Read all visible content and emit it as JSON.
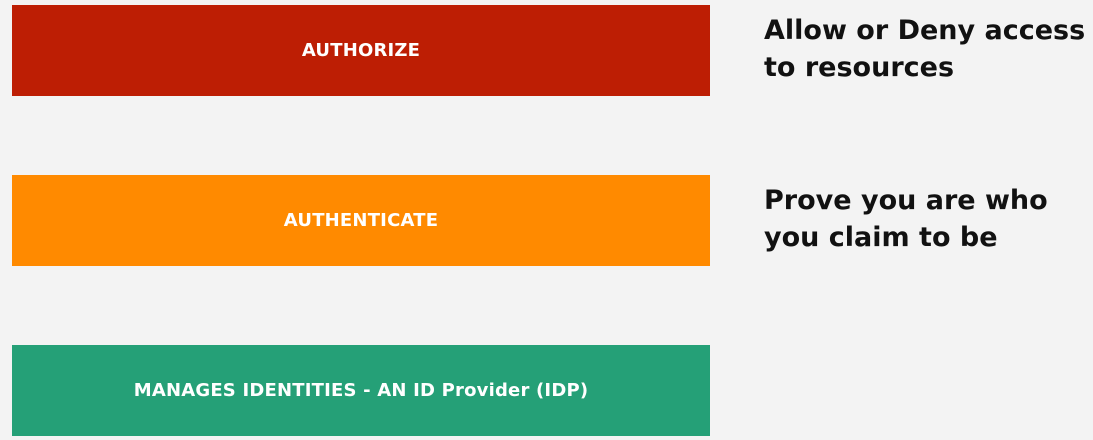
{
  "layers": [
    {
      "label": "AUTHORIZE",
      "color": "#bd1e04",
      "description": "Allow or Deny access to resources"
    },
    {
      "label": "AUTHENTICATE",
      "color": "#ff8a00",
      "description": "Prove you are who you claim to be"
    },
    {
      "label": "MANAGES IDENTITIES - AN ID Provider (IDP)",
      "color": "#25a077",
      "description": ""
    }
  ]
}
